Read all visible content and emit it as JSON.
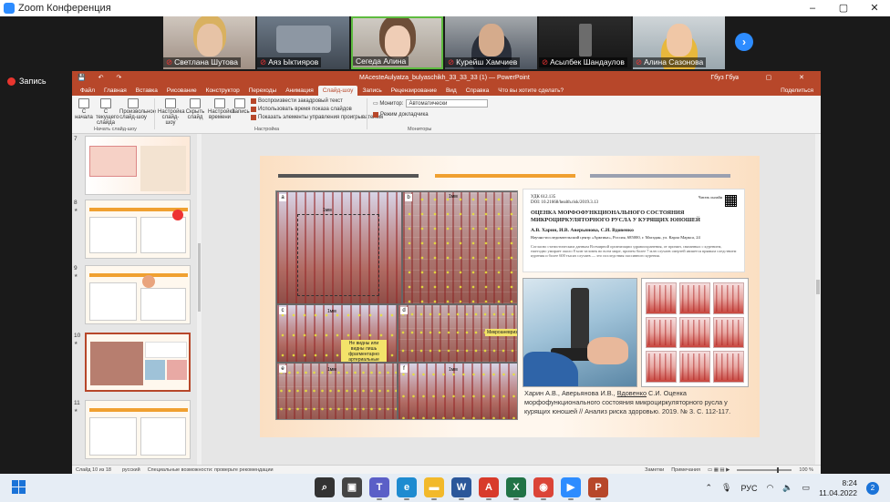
{
  "zoom": {
    "window_title": "Zoom Конференция",
    "window_controls": [
      "–",
      "▢",
      "✕"
    ],
    "recording_label": "Запись",
    "participants": [
      {
        "name": "Светлана Шутова",
        "muted": true,
        "active": false
      },
      {
        "name": "Аяз Ыктияров",
        "muted": true,
        "active": false
      },
      {
        "name": "Сегеда Алина",
        "muted": false,
        "active": true
      },
      {
        "name": "Курейш Хамчиев",
        "muted": true,
        "active": false
      },
      {
        "name": "Асылбек Шандаулов",
        "muted": true,
        "active": false
      },
      {
        "name": "Алина Сазонова",
        "muted": true,
        "active": false
      }
    ],
    "next_button": "›"
  },
  "ppt": {
    "doc_title": "MAcesteAulyatza_bulyaschikh_33_33_33 (1) — PowerPoint",
    "user": "Гбуз Гбуз",
    "tabs": [
      "Файл",
      "Главная",
      "Вставка",
      "Рисование",
      "Конструктор",
      "Переходы",
      "Анимация",
      "Слайд-шоу",
      "Запись",
      "Рецензирование",
      "Вид",
      "Справка",
      "Что вы хотите сделать?"
    ],
    "active_tab": "Слайд-шоу",
    "share_label": "Поделиться",
    "ribbon": {
      "buttons": [
        {
          "label": "С начала"
        },
        {
          "label": "С текущего слайда"
        },
        {
          "label": "Произвольное слайд-шоу"
        },
        {
          "label": "Настройка слайд-шоу"
        },
        {
          "label": "Скрыть слайд"
        },
        {
          "label": "Настройка времени"
        },
        {
          "label": "Запись"
        }
      ],
      "checks": [
        {
          "label": "Воспроизвести закадровый текст",
          "checked": true
        },
        {
          "label": "Использовать время показа слайдов",
          "checked": true
        },
        {
          "label": "Показать элементы управления проигрывателем",
          "checked": true
        }
      ],
      "group_start": "Начать слайд-шоу",
      "group_setup": "Настройка",
      "group_monitors": "Мониторы",
      "monitor_label": "Монитор:",
      "monitor_value": "Автоматически",
      "presenter_label": "Режим докладчика"
    },
    "thumbnails": [
      {
        "num": "7",
        "selected": false
      },
      {
        "num": "8",
        "selected": false
      },
      {
        "num": "9",
        "selected": false
      },
      {
        "num": "10",
        "selected": true
      },
      {
        "num": "11",
        "selected": false
      }
    ],
    "slide": {
      "stripe_colors": [
        "#555555",
        "#f0a030",
        "#9aa0b0"
      ],
      "panel_labels": [
        "a",
        "b",
        "c",
        "d",
        "e",
        "f"
      ],
      "panel_scale_labels": [
        "1мм",
        "1мм",
        "1мм",
        "1мм",
        "1мм"
      ],
      "annotations": [
        "Не видны или видны лишь фрагментарно артериальные капилляры",
        "Микроаневризмы"
      ],
      "paper": {
        "udk": "УДК 612.135",
        "doi": "DOI: 10.21668/health.risk/2019.3.13",
        "qr_label": "Читать онлайн",
        "title": "ОЦЕНКА МОРФОФУНКЦИОНАЛЬНОГО СОСТОЯНИЯ МИКРОЦИРКУЛЯТОРНОГО РУСЛА У КУРЯЩИХ ЮНОШЕЙ",
        "authors": "А.В. Харин, И.В. Аверьянова, С.И. Вдовенко",
        "institution": "Научно-исследовательский центр «Арктика», Россия, 685000, г. Магадан, ул. Карла Маркса, 24",
        "abstract": "Согласно статистическим данным Всемирной организации здравоохранения, от причин, связанных с курением, ежегодно умирает около 8 млн человек во всем мире, причем более 7 млн случаев смертей является прямым следствием курения и более 600 тысяч случаев — это последствия пассивного курения."
      },
      "citation_pre": "Харин А.В., Аверьянова И.В., ",
      "citation_author_underlined": "Вдовенко",
      "citation_post": " С.И. Оценка морфофункционального состояния микроциркуляторного русла у курящих юношей // Анализ риска здоровью. 2019. № 3. С. 112-117."
    },
    "status": {
      "slide_info": "Слайд 10 из 18",
      "language": "русский",
      "accessibility": "Специальные возможности: проверьте рекомендации",
      "notes": "Заметки",
      "comments": "Примечания",
      "zoom": "100 %"
    }
  },
  "taskbar": {
    "language": "РУС",
    "time": "8:24",
    "date": "11.04.2022",
    "notifications": "2",
    "apps": [
      {
        "name": "search",
        "color": "#333333",
        "glyph": "⌕"
      },
      {
        "name": "task-view",
        "color": "#444444",
        "glyph": "▣"
      },
      {
        "name": "teams",
        "color": "#5b5fc7",
        "glyph": "T"
      },
      {
        "name": "edge",
        "color": "#1e8bd0",
        "glyph": "e"
      },
      {
        "name": "explorer",
        "color": "#f2b92b",
        "glyph": "▬"
      },
      {
        "name": "word",
        "color": "#2b579a",
        "glyph": "W"
      },
      {
        "name": "pdf",
        "color": "#d83b2b",
        "glyph": "A"
      },
      {
        "name": "excel",
        "color": "#217346",
        "glyph": "X"
      },
      {
        "name": "chrome",
        "color": "#db4437",
        "glyph": "◉"
      },
      {
        "name": "zoom",
        "color": "#2d8cff",
        "glyph": "▶"
      },
      {
        "name": "powerpoint",
        "color": "#b7472a",
        "glyph": "P"
      }
    ]
  }
}
